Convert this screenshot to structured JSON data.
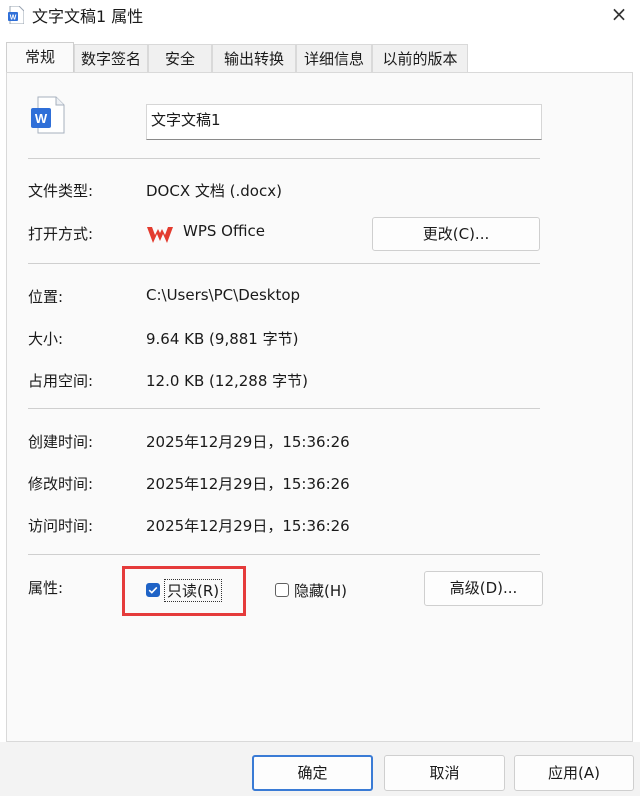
{
  "window": {
    "title": "文字文稿1 属性",
    "close_symbol": "×"
  },
  "tabs": [
    {
      "label": "常规",
      "active": true
    },
    {
      "label": "数字签名",
      "active": false
    },
    {
      "label": "安全",
      "active": false
    },
    {
      "label": "输出转换",
      "active": false
    },
    {
      "label": "详细信息",
      "active": false
    },
    {
      "label": "以前的版本",
      "active": false
    }
  ],
  "file": {
    "name": "文字文稿1",
    "icon": "word-document-icon",
    "icon_letter": "W",
    "type_label": "文件类型:",
    "type_value": "DOCX 文档 (.docx)",
    "opens_label": "打开方式:",
    "opens_value": "WPS Office",
    "opens_icon": "wps-logo-icon",
    "change_button": "更改(C)...",
    "location_label": "位置:",
    "location_value": "C:\\Users\\PC\\Desktop",
    "size_label": "大小:",
    "size_value": "9.64 KB (9,881 字节)",
    "size_on_disk_label": "占用空间:",
    "size_on_disk_value": "12.0 KB (12,288 字节)",
    "created_label": "创建时间:",
    "created_value": "2025年12月29日，15:36:26",
    "modified_label": "修改时间:",
    "modified_value": "2025年12月29日，15:36:26",
    "accessed_label": "访问时间:",
    "accessed_value": "2025年12月29日，15:36:26",
    "attributes_label": "属性:",
    "readonly_label": "只读(R)",
    "readonly_checked": true,
    "hidden_label": "隐藏(H)",
    "hidden_checked": false,
    "advanced_button": "高级(D)..."
  },
  "footer": {
    "ok_button": "确定",
    "cancel_button": "取消",
    "apply_button": "应用(A)"
  },
  "colors": {
    "accent": "#1f63c6",
    "highlight": "#e53b3b",
    "wps_red": "#e33b2e"
  }
}
